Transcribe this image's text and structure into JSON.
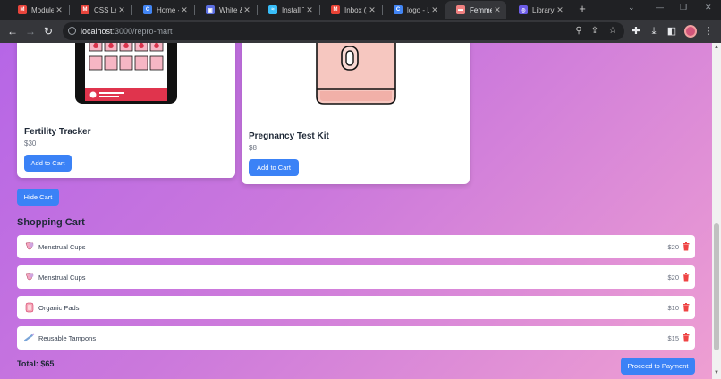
{
  "browser": {
    "tabs": [
      {
        "title": "Modules",
        "favicon": "mongodb-icon",
        "color": "#e8453c"
      },
      {
        "title": "CSS Lear",
        "favicon": "mongodb-icon",
        "color": "#e8453c"
      },
      {
        "title": "Home - (",
        "favicon": "c-logo-icon",
        "color": "#4285f4"
      },
      {
        "title": "White &",
        "favicon": "window-icon",
        "color": "#5b6ee1"
      },
      {
        "title": "Install Ta",
        "favicon": "tailwind-icon",
        "color": "#38bdf8"
      },
      {
        "title": "Inbox (3",
        "favicon": "gmail-icon",
        "color": "#ea4335"
      },
      {
        "title": "logo - Lo",
        "favicon": "c-logo-icon",
        "color": "#4285f4"
      },
      {
        "title": "Femme",
        "favicon": "femme-icon",
        "color": "#f08080"
      },
      {
        "title": "Library |",
        "favicon": "library-icon",
        "color": "#6c5ce7"
      }
    ],
    "active_tab_index": 7,
    "url_host": "localhost",
    "url_path": ":3000/repro-mart"
  },
  "products": [
    {
      "name": "Fertility Tracker",
      "price": "$30",
      "button": "Add to Cart"
    },
    {
      "name": "Pregnancy Test Kit",
      "price": "$8",
      "button": "Add to Cart"
    }
  ],
  "hide_cart_label": "Hide Cart",
  "cart": {
    "title": "Shopping Cart",
    "items": [
      {
        "name": "Menstrual Cups",
        "price": "$20",
        "icon": "menstrual-cup-icon"
      },
      {
        "name": "Menstrual Cups",
        "price": "$20",
        "icon": "menstrual-cup-icon"
      },
      {
        "name": "Organic Pads",
        "price": "$10",
        "icon": "pads-icon"
      },
      {
        "name": "Reusable Tampons",
        "price": "$15",
        "icon": "tampon-icon"
      }
    ],
    "total_label": "Total: $65",
    "checkout_label": "Proceed to Payment"
  },
  "colors": {
    "accent": "#3b82f6",
    "danger": "#ef4444",
    "gradient_start": "#b666e6",
    "gradient_end": "#ee9fd2"
  }
}
